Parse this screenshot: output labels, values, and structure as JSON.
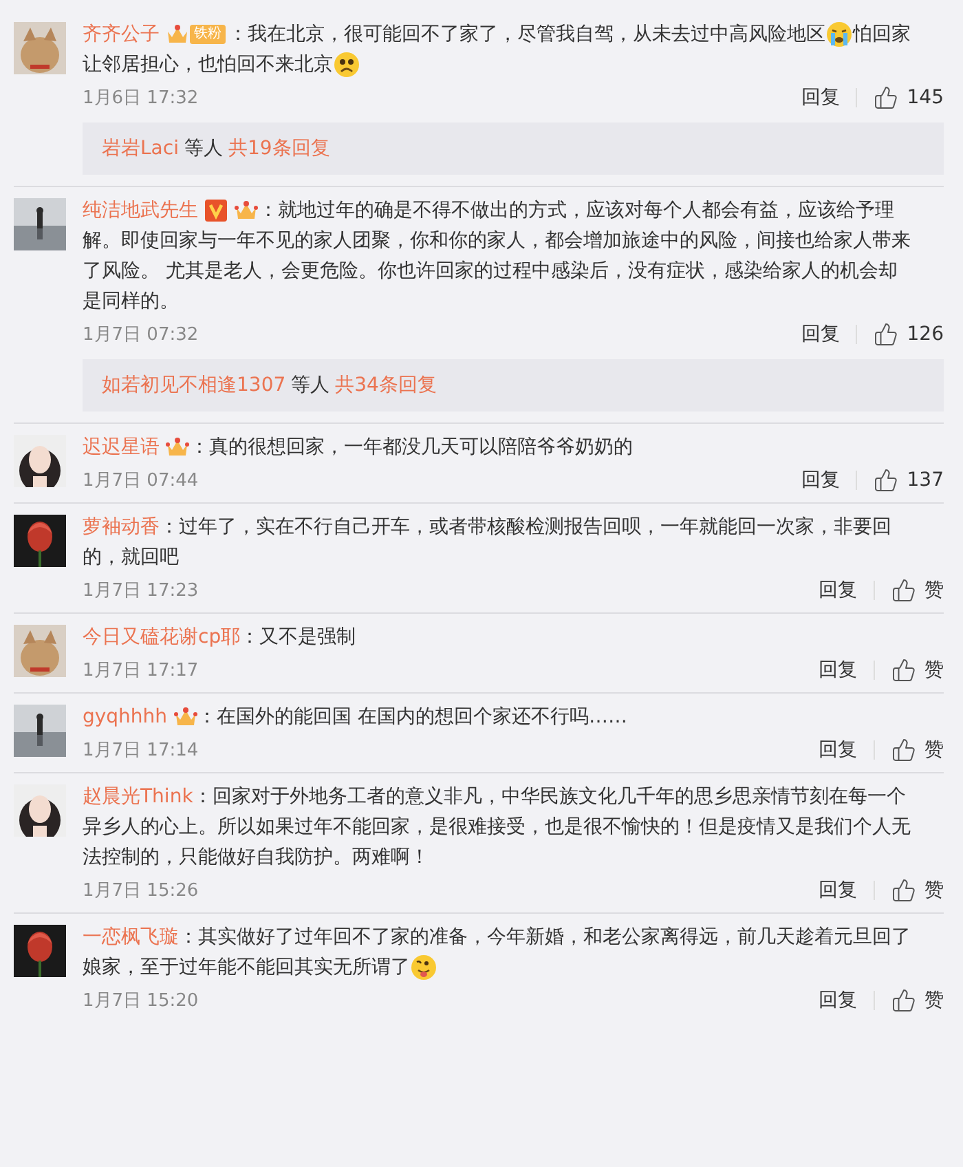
{
  "comments": [
    {
      "user": "齐齐公子",
      "badges": [
        {
          "kind": "fan",
          "label": "铁粉"
        }
      ],
      "parts": [
        {
          "kind": "text",
          "text": "：我在北京，很可能回不了家了，尽管我自驾，从未去过中高风险地区"
        },
        {
          "kind": "cry"
        },
        {
          "kind": "text",
          "text": "怕回家让邻居担心，也怕回不来北京"
        },
        {
          "kind": "sad"
        }
      ],
      "time": "1月6日 17:32",
      "reply": "回复",
      "like": "145",
      "thread": {
        "users": "岩岩Laci",
        "suffix": "等人",
        "count": "共19条回复"
      }
    },
    {
      "user": "纯洁地武先生",
      "badges": [
        {
          "kind": "verified"
        },
        {
          "kind": "crown"
        }
      ],
      "parts": [
        {
          "kind": "text",
          "text": "：就地过年的确是不得不做出的方式，应该对每个人都会有益，应该给予理解。即使回家与一年不见的家人团聚，你和你的家人，都会增加旅途中的风险，间接也给家人带来了风险。 尤其是老人，会更危险。你也许回家的过程中感染后，没有症状，感染给家人的机会却是同样的。"
        }
      ],
      "time": "1月7日 07:32",
      "reply": "回复",
      "like": "126",
      "thread": {
        "users": "如若初见不相逢1307",
        "suffix": "等人",
        "count": "共34条回复"
      }
    },
    {
      "user": "迟迟星语",
      "badges": [
        {
          "kind": "crown"
        }
      ],
      "parts": [
        {
          "kind": "text",
          "text": "：真的很想回家，一年都没几天可以陪陪爷爷奶奶的"
        }
      ],
      "time": "1月7日 07:44",
      "reply": "回复",
      "like": "137"
    },
    {
      "user": "萝袖动香",
      "parts": [
        {
          "kind": "text",
          "text": "：过年了，实在不行自己开车，或者带核酸检测报告回呗，一年就能回一次家，非要回的，就回吧"
        }
      ],
      "time": "1月7日 17:23",
      "reply": "回复",
      "like": "赞"
    },
    {
      "user": "今日又磕花谢cp耶",
      "parts": [
        {
          "kind": "text",
          "text": "：又不是强制"
        }
      ],
      "time": "1月7日 17:17",
      "reply": "回复",
      "like": "赞"
    },
    {
      "user": "gyqhhhh",
      "badges": [
        {
          "kind": "crown"
        }
      ],
      "parts": [
        {
          "kind": "text",
          "text": "：在国外的能回国 在国内的想回个家还不行吗……"
        }
      ],
      "time": "1月7日 17:14",
      "reply": "回复",
      "like": "赞"
    },
    {
      "user": "赵晨光Think",
      "parts": [
        {
          "kind": "text",
          "text": "：回家对于外地务工者的意义非凡，中华民族文化几千年的思乡思亲情节刻在每一个异乡人的心上。所以如果过年不能回家，是很难接受，也是很不愉快的！但是疫情又是我们个人无法控制的，只能做好自我防护。两难啊！"
        }
      ],
      "time": "1月7日 15:26",
      "reply": "回复",
      "like": "赞"
    },
    {
      "user": "一恋枫飞璇",
      "parts": [
        {
          "kind": "text",
          "text": "：其实做好了过年回不了家的准备，今年新婚，和老公家离得远，前几天趁着元旦回了娘家，至于过年能不能回其实无所谓了"
        },
        {
          "kind": "tongue"
        }
      ],
      "time": "1月7日 15:20",
      "reply": "回复",
      "like": "赞"
    }
  ]
}
